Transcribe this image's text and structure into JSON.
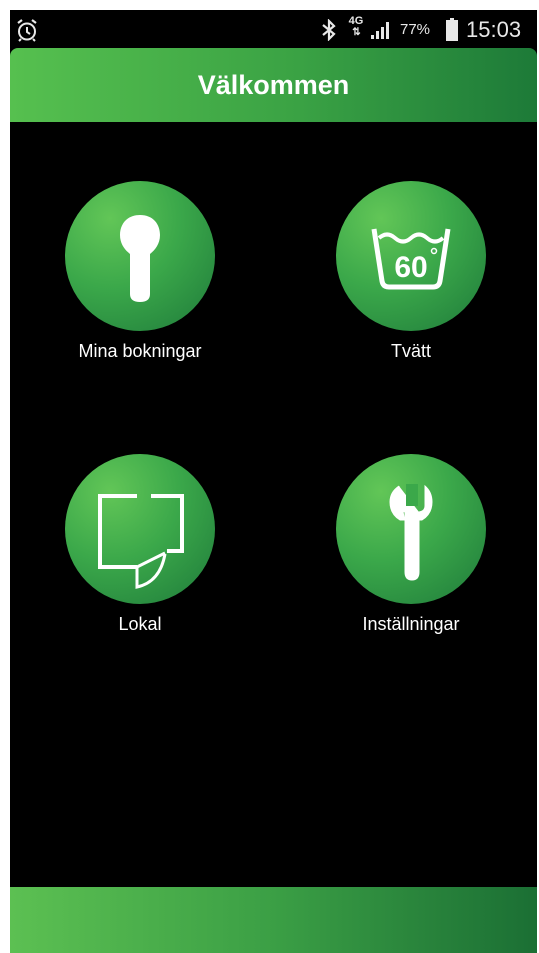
{
  "status_bar": {
    "network": "4G",
    "battery_percent": "77%",
    "time": "15:03",
    "icons": [
      "alarm-icon",
      "bluetooth-icon",
      "network-4g-icon",
      "signal-icon",
      "battery-icon"
    ]
  },
  "header": {
    "title": "Välkommen"
  },
  "menu": {
    "items": [
      {
        "label": "Mina bokningar",
        "icon": "key-cylinder-icon"
      },
      {
        "label": "Tvätt",
        "icon": "wash-60-icon",
        "icon_text": "60"
      },
      {
        "label": "Lokal",
        "icon": "floor-plan-icon"
      },
      {
        "label": "Inställningar",
        "icon": "wrench-icon"
      }
    ]
  },
  "colors": {
    "accent_light": "#56c04f",
    "accent_dark": "#1d7a38",
    "background": "#000000",
    "text": "#ffffff"
  }
}
